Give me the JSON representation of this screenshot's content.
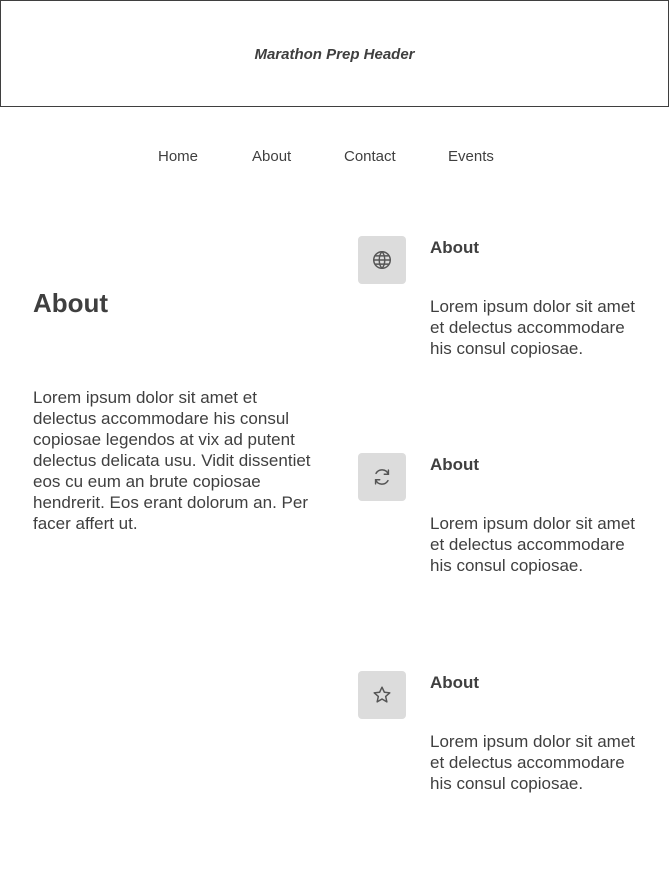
{
  "header": {
    "title": "Marathon Prep Header"
  },
  "nav": {
    "items": [
      {
        "label": "Home"
      },
      {
        "label": "About"
      },
      {
        "label": "Contact"
      },
      {
        "label": "Events"
      }
    ]
  },
  "intro": {
    "title": "About",
    "text": "Lorem ipsum dolor sit amet et delectus accommodare his consul copiosae legendos at vix ad putent delectus delicata usu. Vidit dissentiet eos cu eum an brute copiosae hendrerit. Eos erant dolorum an. Per facer affert ut."
  },
  "features": [
    {
      "icon": "globe-icon",
      "title": "About",
      "text": "Lorem ipsum dolor sit amet et delectus accommodare his consul copiosae."
    },
    {
      "icon": "refresh-icon",
      "title": "About",
      "text": "Lorem ipsum dolor sit amet et delectus accommodare his consul copiosae."
    },
    {
      "icon": "star-icon",
      "title": "About",
      "text": "Lorem ipsum dolor sit amet et delectus accommodare his consul copiosae."
    }
  ]
}
